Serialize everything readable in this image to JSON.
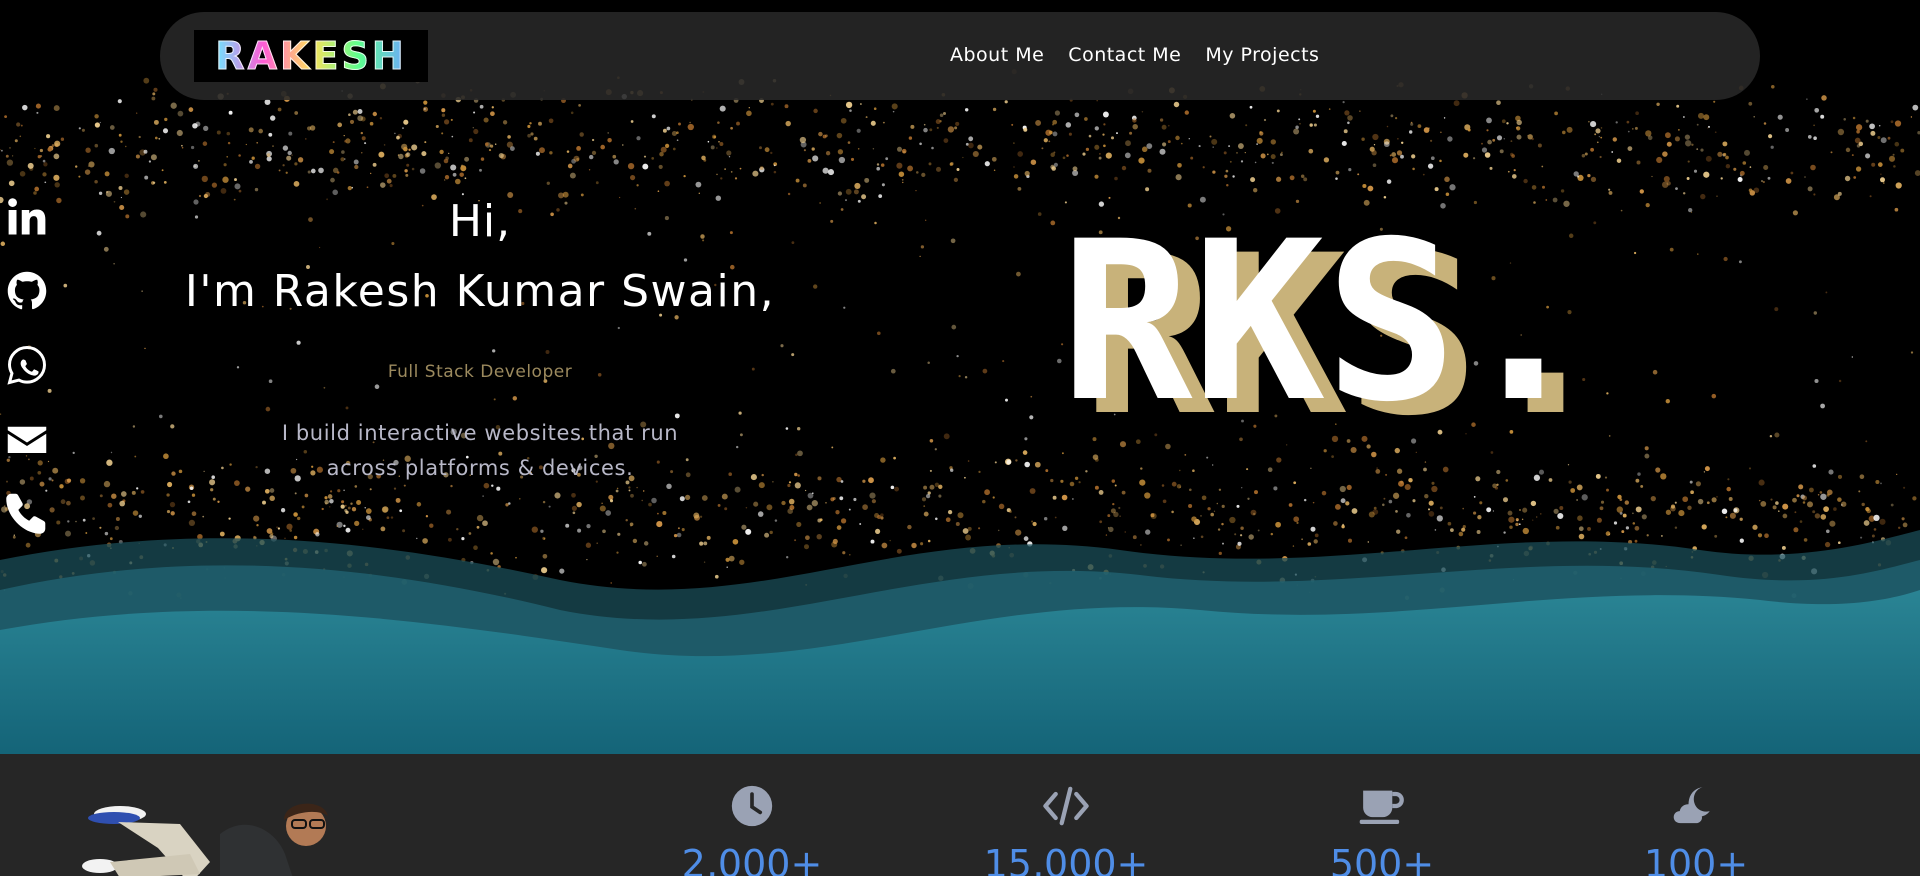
{
  "navbar": {
    "logo_text": "RAKESH",
    "links": [
      {
        "label": "About Me"
      },
      {
        "label": "Contact Me"
      },
      {
        "label": "My Projects"
      }
    ]
  },
  "social": {
    "icons": [
      "linkedin-icon",
      "github-icon",
      "whatsapp-icon",
      "email-icon",
      "phone-icon"
    ]
  },
  "intro": {
    "greeting": "Hi,",
    "name_line": "I'm Rakesh Kumar Swain,",
    "role": "Full Stack Developer",
    "tagline": "I build interactive websites that run across platforms & devices."
  },
  "monogram": {
    "text": "RKS."
  },
  "stats": [
    {
      "icon": "clock-icon",
      "value": "2,000+"
    },
    {
      "icon": "code-icon",
      "value": "15,000+"
    },
    {
      "icon": "coffee-cup-icon",
      "value": "500+"
    },
    {
      "icon": "moon-cloud-icon",
      "value": "100+"
    }
  ],
  "colors": {
    "background": "#000000",
    "navbar": "#282828",
    "accent_gold": "#c8b27a",
    "role_text": "#9c8a5e",
    "wave_teal": "#1d6f80",
    "stats_bg": "#262626",
    "stat_value": "#4f8de6",
    "stat_icon": "#9aa2b4"
  }
}
